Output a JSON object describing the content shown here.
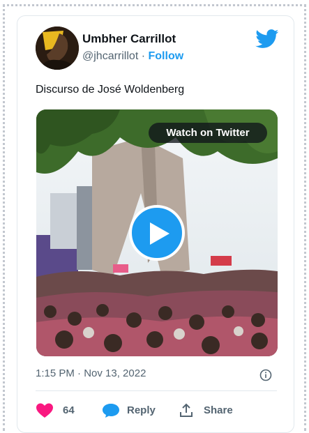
{
  "author": {
    "name": "Umbher Carrillot",
    "handle": "@jhcarrillot",
    "separator": "·",
    "follow_label": "Follow"
  },
  "tweet": {
    "text": "Discurso de José Woldenberg",
    "timestamp": "1:15 PM · Nov 13, 2022"
  },
  "media": {
    "watch_label": "Watch on Twitter"
  },
  "actions": {
    "like_count": "64",
    "reply_label": "Reply",
    "share_label": "Share"
  },
  "colors": {
    "accent": "#1d9bf0",
    "like": "#f91880",
    "text_primary": "#0f1419",
    "text_secondary": "#536471"
  },
  "icons": [
    "twitter-bird-icon",
    "play-icon",
    "info-icon",
    "heart-icon",
    "reply-bubble-icon",
    "share-icon"
  ]
}
